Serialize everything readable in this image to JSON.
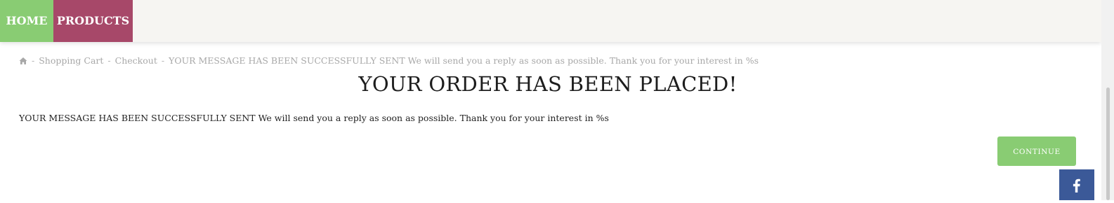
{
  "nav": {
    "home_label": "HOME",
    "products_label": "PRODUCTS"
  },
  "breadcrumb": {
    "home_icon": "home-icon",
    "separator": "-",
    "items": [
      "Shopping Cart",
      "Checkout",
      "YOUR MESSAGE HAS BEEN SUCCESSFULLY SENT We will send you a reply as soon as possible. Thank you for your interest in %s"
    ]
  },
  "main": {
    "title": "YOUR ORDER HAS BEEN PLACED!",
    "message": "YOUR MESSAGE HAS BEEN SUCCESSFULLY SENT We will send you a reply as soon as possible. Thank you for your interest in %s",
    "continue_label": "CONTINUE"
  },
  "social": {
    "facebook_icon": "facebook-icon"
  },
  "colors": {
    "home_bg": "#89cc73",
    "products_bg": "#a74869",
    "continue_bg": "#89cc73",
    "facebook_bg": "#3b5998"
  }
}
